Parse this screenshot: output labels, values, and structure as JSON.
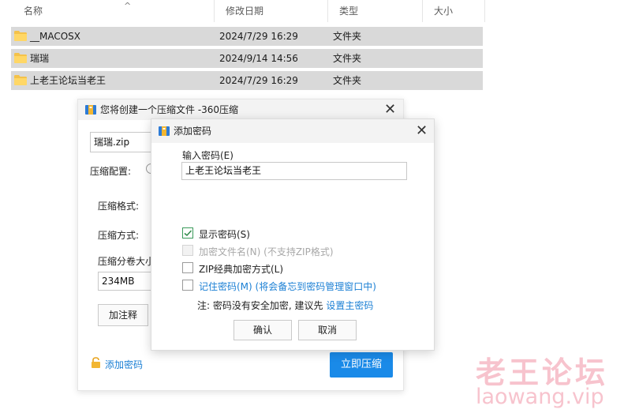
{
  "explorer": {
    "columns": [
      "名称",
      "修改日期",
      "类型",
      "大小"
    ],
    "rows": [
      {
        "name": "__MACOSX",
        "date": "2024/7/29 16:29",
        "type": "文件夹"
      },
      {
        "name": "瑞瑞",
        "date": "2024/9/14 14:56",
        "type": "文件夹"
      },
      {
        "name": "上老王论坛当老王",
        "date": "2024/7/29 16:29",
        "type": "文件夹"
      }
    ]
  },
  "main_dialog": {
    "title": "您将创建一个压缩文件 -360压缩",
    "filename": "瑞瑞.zip",
    "config_label": "压缩配置:",
    "format_label": "压缩格式:",
    "method_label": "压缩方式:",
    "split_label": "压缩分卷大小",
    "split_value": "234MB",
    "comment_button": "加注释",
    "add_password_link": "添加密码",
    "compress_button": "立即压缩"
  },
  "password_dialog": {
    "title": "添加密码",
    "input_label": "输入密码(E)",
    "password_value": "上老王论坛当老王",
    "options": [
      {
        "label": "显示密码(S)",
        "checked": true,
        "disabled": false
      },
      {
        "label": "加密文件名(N) (不支持ZIP格式)",
        "checked": false,
        "disabled": true
      },
      {
        "label": "ZIP经典加密方式(L)",
        "checked": false,
        "disabled": false
      },
      {
        "label": "记住密码(M) (将会备忘到密码管理窗口中)",
        "checked": false,
        "disabled": false
      }
    ],
    "note_text": "注: 密码没有安全加密, 建议先",
    "note_link": "设置主密码",
    "ok_button": "确认",
    "cancel_button": "取消"
  },
  "watermark": {
    "cn": "老王论坛",
    "url": "laowang.vip"
  }
}
